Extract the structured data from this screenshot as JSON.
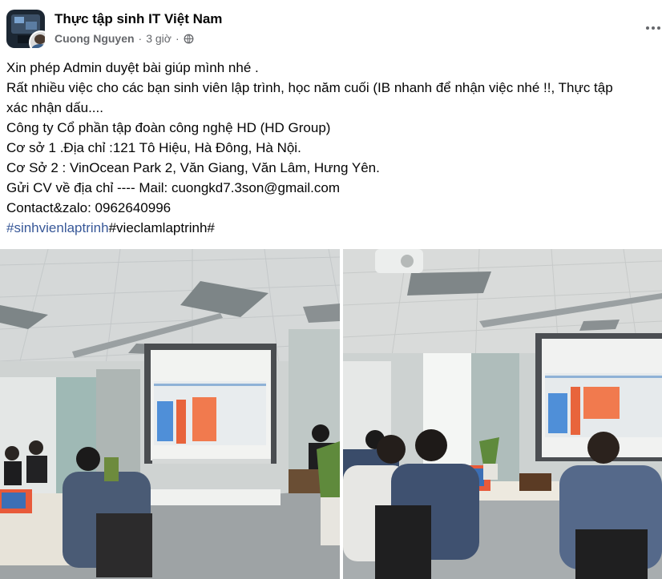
{
  "post": {
    "group_name": "Thực tập sinh IT Việt Nam",
    "author": "Cuong Nguyen",
    "separator": "·",
    "time": "3 giờ",
    "lines": [
      "Xin phép Admin duyệt bài giúp mình nhé .",
      "Rất nhiều việc cho các bạn sinh viên lập trình, học năm cuối (IB nhanh để nhận việc nhé !!, Thực tập",
      "xác nhận dấu....",
      "Công ty Cổ phần tập đoàn công nghệ HD (HD Group)",
      "Cơ sở 1 .Địa chỉ :121 Tô Hiệu, Hà Đông, Hà Nội.",
      "Cơ Sở 2 : VinOcean Park 2, Văn Giang, Văn Lâm, Hưng Yên.",
      "Gửi CV về địa chỉ ---- Mail: cuongkd7.3son@gmail.com",
      "Contact&zalo: 0962640996"
    ],
    "hashtag_1": "#sinhvienlaptrinh",
    "hashtag_2": "#vieclamlaptrinh#"
  },
  "colors": {
    "text": "#050505",
    "meta": "#65676b",
    "hashtag": "#385898"
  },
  "icons": {
    "privacy": "globe-icon",
    "menu": "more-horizontal-icon"
  }
}
